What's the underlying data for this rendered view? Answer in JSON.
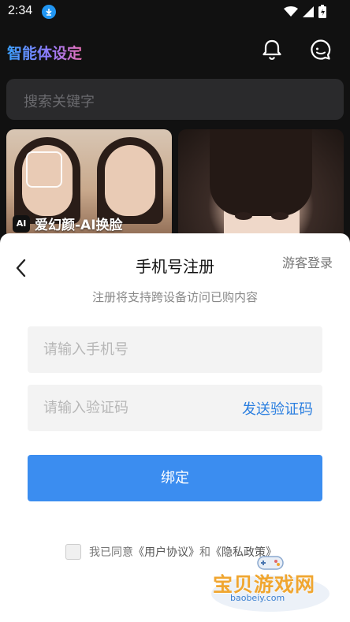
{
  "status_bar": {
    "time": "2:34"
  },
  "header": {
    "title": "智能体设定"
  },
  "search": {
    "placeholder": "搜索关键字"
  },
  "cards": [
    {
      "label": "爱幻颜-AI换脸",
      "badge": "AI"
    },
    {
      "label": ""
    }
  ],
  "sheet": {
    "title": "手机号注册",
    "guest_login": "游客登录",
    "subtitle": "注册将支持跨设备访问已购内容",
    "phone_placeholder": "请输入手机号",
    "code_placeholder": "请输入验证码",
    "send_code": "发送验证码",
    "bind_button": "绑定",
    "agree_prefix": "我已同意",
    "user_agreement": "《用户协议》",
    "and": "和",
    "privacy_policy": "《隐私政策》"
  },
  "watermark": {
    "text": "宝贝游戏网",
    "url": "baobeiy.com"
  },
  "colors": {
    "accent_blue": "#3b8df0",
    "link_blue": "#2b7fe0",
    "watermark_orange": "#f0a630"
  },
  "icons": [
    "download-icon",
    "wifi-icon",
    "signal-icon",
    "battery-icon",
    "bell-icon",
    "chat-icon",
    "chevron-left-icon"
  ]
}
